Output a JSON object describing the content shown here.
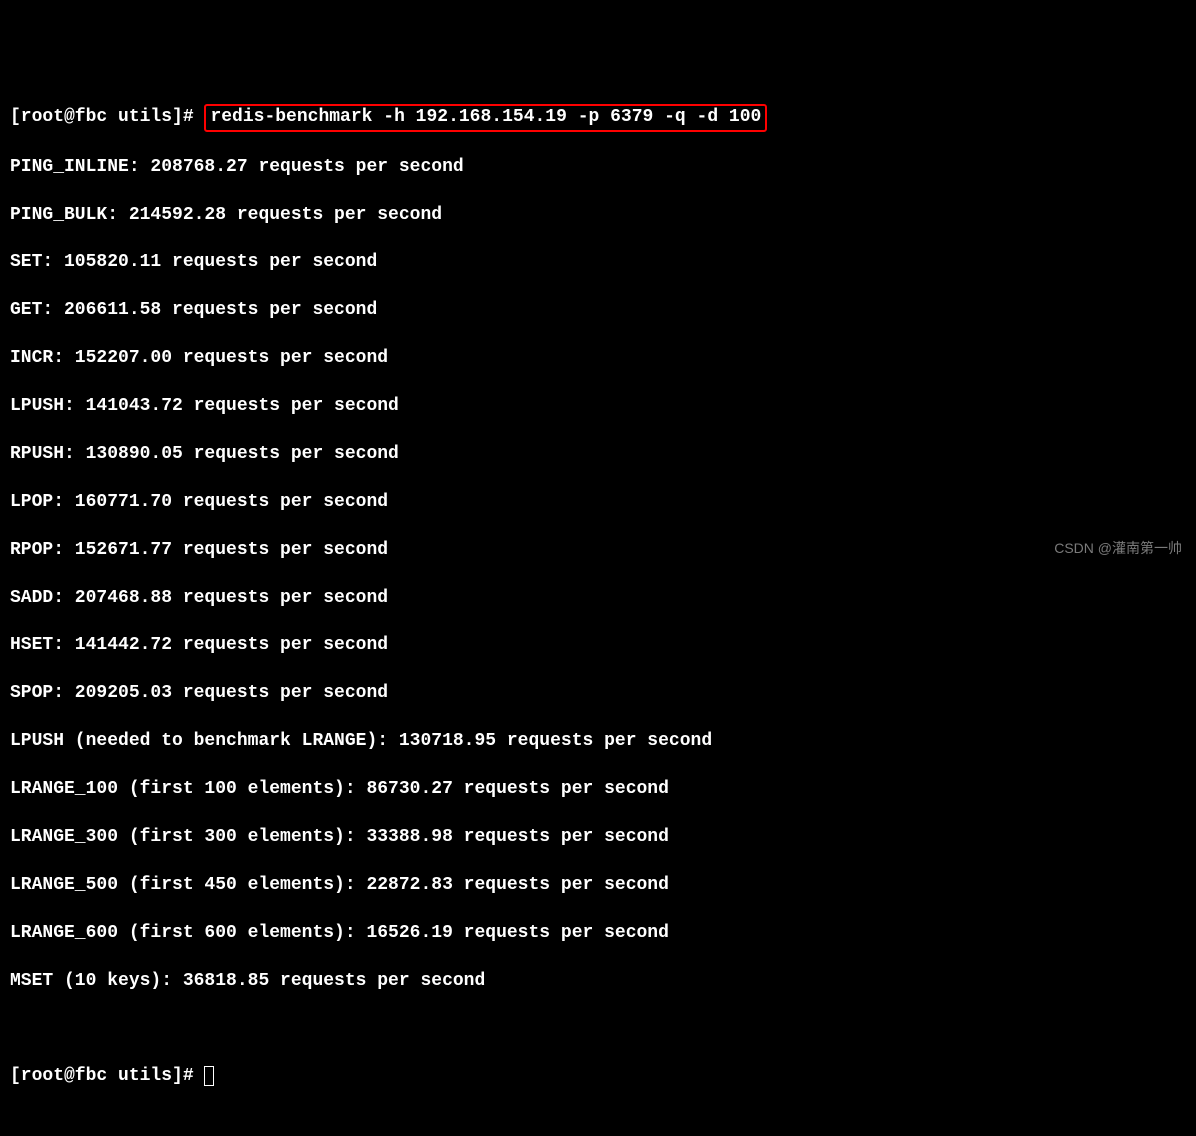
{
  "prompt1": "[root@fbc utils]# ",
  "command": "redis-benchmark -h 192.168.154.19 -p 6379 -q -d 100",
  "results": [
    "PING_INLINE: 208768.27 requests per second",
    "PING_BULK: 214592.28 requests per second",
    "SET: 105820.11 requests per second",
    "GET: 206611.58 requests per second",
    "INCR: 152207.00 requests per second",
    "LPUSH: 141043.72 requests per second",
    "RPUSH: 130890.05 requests per second",
    "LPOP: 160771.70 requests per second",
    "RPOP: 152671.77 requests per second",
    "SADD: 207468.88 requests per second",
    "HSET: 141442.72 requests per second",
    "SPOP: 209205.03 requests per second",
    "LPUSH (needed to benchmark LRANGE): 130718.95 requests per second",
    "LRANGE_100 (first 100 elements): 86730.27 requests per second",
    "LRANGE_300 (first 300 elements): 33388.98 requests per second",
    "LRANGE_500 (first 450 elements): 22872.83 requests per second",
    "LRANGE_600 (first 600 elements): 16526.19 requests per second",
    "MSET (10 keys): 36818.85 requests per second"
  ],
  "prompt2": "[root@fbc utils]# ",
  "watermark": "CSDN @灌南第一帅"
}
